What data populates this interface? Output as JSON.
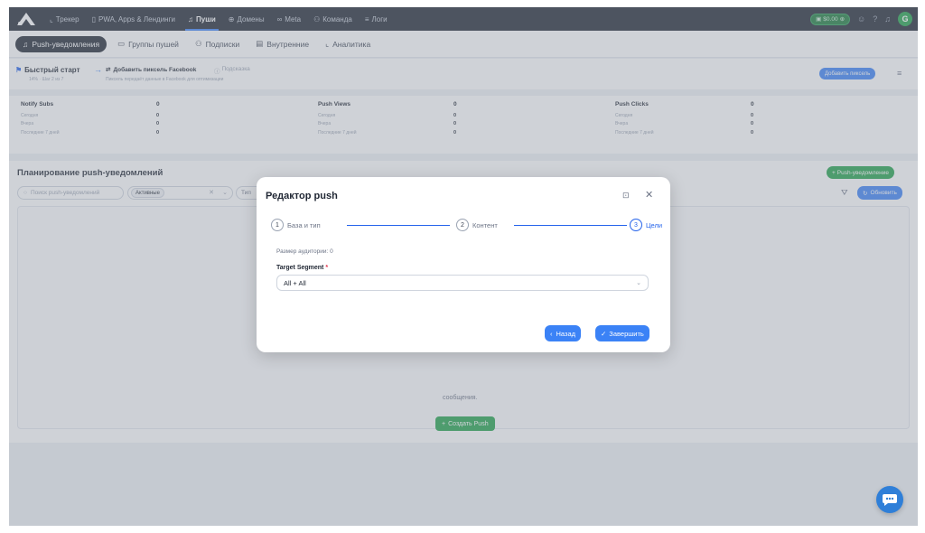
{
  "topnav": {
    "items": [
      {
        "label": "Трекер",
        "icon": "chart-icon"
      },
      {
        "label": "PWA, Apps & Лендинги",
        "icon": "phone-icon"
      },
      {
        "label": "Пуши",
        "icon": "bell-icon"
      },
      {
        "label": "Домены",
        "icon": "globe-icon"
      },
      {
        "label": "Meta",
        "icon": "infinity-icon"
      },
      {
        "label": "Команда",
        "icon": "team-icon"
      },
      {
        "label": "Логи",
        "icon": "list-icon"
      }
    ],
    "active_index": 2,
    "balance": "$0.00",
    "user_initial": "G"
  },
  "subnav": {
    "items": [
      {
        "label": "Push-уведомления",
        "icon": "bell-icon"
      },
      {
        "label": "Группы пушей",
        "icon": "folder-icon"
      },
      {
        "label": "Подписки",
        "icon": "team-icon"
      },
      {
        "label": "Внутренние",
        "icon": "inbox-icon"
      },
      {
        "label": "Аналитика",
        "icon": "chart-icon"
      }
    ],
    "active_index": 0
  },
  "quick_start": {
    "title": "Быстрый старт",
    "progress_text": "14% · Шаг 2 из 7",
    "task_title": "Добавить пиксель Facebook",
    "task_subtitle": "Пиксель передаёт данные в Facebook для оптимизации",
    "hint_label": "Подсказка",
    "add_pixel_button": "Добавить пиксель"
  },
  "stats": [
    {
      "title": "Notify Subs",
      "total": "0",
      "rows": [
        {
          "label": "Сегодня",
          "value": "0"
        },
        {
          "label": "Вчера",
          "value": "0"
        },
        {
          "label": "Последние 7 дней",
          "value": "0"
        }
      ]
    },
    {
      "title": "Push Views",
      "total": "0",
      "rows": [
        {
          "label": "Сегодня",
          "value": "0"
        },
        {
          "label": "Вчера",
          "value": "0"
        },
        {
          "label": "Последние 7 дней",
          "value": "0"
        }
      ]
    },
    {
      "title": "Push Clicks",
      "total": "0",
      "rows": [
        {
          "label": "Сегодня",
          "value": "0"
        },
        {
          "label": "Вчера",
          "value": "0"
        },
        {
          "label": "Последние 7 дней",
          "value": "0"
        }
      ]
    }
  ],
  "planning": {
    "title": "Планирование push-уведомлений",
    "new_button": "Push-уведомление",
    "search_placeholder": "Поиск push-уведомлений",
    "status_chip": "Активные",
    "type_placeholder": "Тип",
    "refresh_button": "Обновить",
    "empty_text": "сообщения.",
    "create_button": "Создать Push"
  },
  "modal": {
    "title": "Редактор push",
    "steps": [
      {
        "num": "1",
        "label": "База и тип"
      },
      {
        "num": "2",
        "label": "Контент"
      },
      {
        "num": "3",
        "label": "Цели"
      }
    ],
    "current_step": 2,
    "audience_text": "Размер аудитории: 0",
    "segment_label": "Target Segment",
    "segment_required": "*",
    "segment_value": "All + All",
    "back_button": "Назад",
    "finish_button": "Завершить"
  }
}
